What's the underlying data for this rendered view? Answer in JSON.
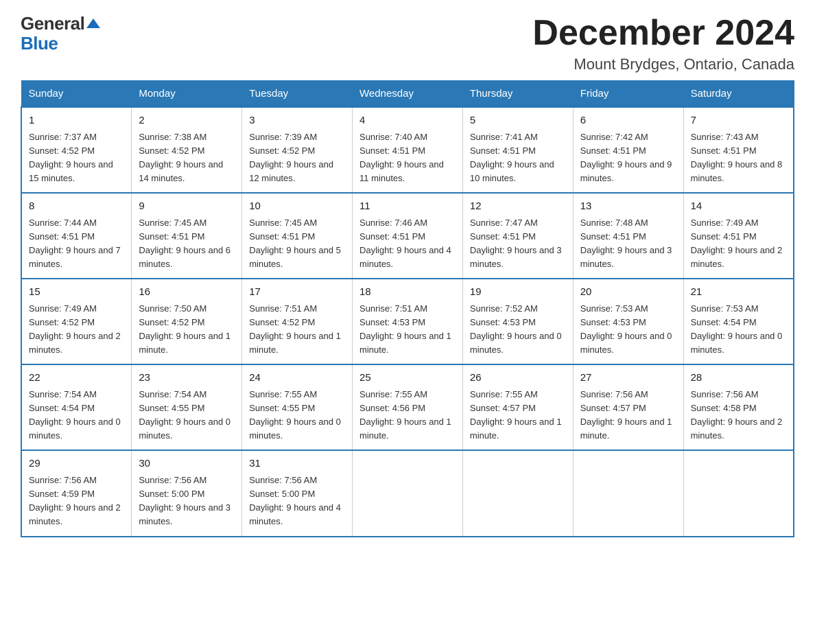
{
  "header": {
    "title": "December 2024",
    "subtitle": "Mount Brydges, Ontario, Canada",
    "logo_line1": "General",
    "logo_line2": "Blue"
  },
  "columns": [
    "Sunday",
    "Monday",
    "Tuesday",
    "Wednesday",
    "Thursday",
    "Friday",
    "Saturday"
  ],
  "weeks": [
    [
      {
        "day": "1",
        "sunrise": "Sunrise: 7:37 AM",
        "sunset": "Sunset: 4:52 PM",
        "daylight": "Daylight: 9 hours and 15 minutes."
      },
      {
        "day": "2",
        "sunrise": "Sunrise: 7:38 AM",
        "sunset": "Sunset: 4:52 PM",
        "daylight": "Daylight: 9 hours and 14 minutes."
      },
      {
        "day": "3",
        "sunrise": "Sunrise: 7:39 AM",
        "sunset": "Sunset: 4:52 PM",
        "daylight": "Daylight: 9 hours and 12 minutes."
      },
      {
        "day": "4",
        "sunrise": "Sunrise: 7:40 AM",
        "sunset": "Sunset: 4:51 PM",
        "daylight": "Daylight: 9 hours and 11 minutes."
      },
      {
        "day": "5",
        "sunrise": "Sunrise: 7:41 AM",
        "sunset": "Sunset: 4:51 PM",
        "daylight": "Daylight: 9 hours and 10 minutes."
      },
      {
        "day": "6",
        "sunrise": "Sunrise: 7:42 AM",
        "sunset": "Sunset: 4:51 PM",
        "daylight": "Daylight: 9 hours and 9 minutes."
      },
      {
        "day": "7",
        "sunrise": "Sunrise: 7:43 AM",
        "sunset": "Sunset: 4:51 PM",
        "daylight": "Daylight: 9 hours and 8 minutes."
      }
    ],
    [
      {
        "day": "8",
        "sunrise": "Sunrise: 7:44 AM",
        "sunset": "Sunset: 4:51 PM",
        "daylight": "Daylight: 9 hours and 7 minutes."
      },
      {
        "day": "9",
        "sunrise": "Sunrise: 7:45 AM",
        "sunset": "Sunset: 4:51 PM",
        "daylight": "Daylight: 9 hours and 6 minutes."
      },
      {
        "day": "10",
        "sunrise": "Sunrise: 7:45 AM",
        "sunset": "Sunset: 4:51 PM",
        "daylight": "Daylight: 9 hours and 5 minutes."
      },
      {
        "day": "11",
        "sunrise": "Sunrise: 7:46 AM",
        "sunset": "Sunset: 4:51 PM",
        "daylight": "Daylight: 9 hours and 4 minutes."
      },
      {
        "day": "12",
        "sunrise": "Sunrise: 7:47 AM",
        "sunset": "Sunset: 4:51 PM",
        "daylight": "Daylight: 9 hours and 3 minutes."
      },
      {
        "day": "13",
        "sunrise": "Sunrise: 7:48 AM",
        "sunset": "Sunset: 4:51 PM",
        "daylight": "Daylight: 9 hours and 3 minutes."
      },
      {
        "day": "14",
        "sunrise": "Sunrise: 7:49 AM",
        "sunset": "Sunset: 4:51 PM",
        "daylight": "Daylight: 9 hours and 2 minutes."
      }
    ],
    [
      {
        "day": "15",
        "sunrise": "Sunrise: 7:49 AM",
        "sunset": "Sunset: 4:52 PM",
        "daylight": "Daylight: 9 hours and 2 minutes."
      },
      {
        "day": "16",
        "sunrise": "Sunrise: 7:50 AM",
        "sunset": "Sunset: 4:52 PM",
        "daylight": "Daylight: 9 hours and 1 minute."
      },
      {
        "day": "17",
        "sunrise": "Sunrise: 7:51 AM",
        "sunset": "Sunset: 4:52 PM",
        "daylight": "Daylight: 9 hours and 1 minute."
      },
      {
        "day": "18",
        "sunrise": "Sunrise: 7:51 AM",
        "sunset": "Sunset: 4:53 PM",
        "daylight": "Daylight: 9 hours and 1 minute."
      },
      {
        "day": "19",
        "sunrise": "Sunrise: 7:52 AM",
        "sunset": "Sunset: 4:53 PM",
        "daylight": "Daylight: 9 hours and 0 minutes."
      },
      {
        "day": "20",
        "sunrise": "Sunrise: 7:53 AM",
        "sunset": "Sunset: 4:53 PM",
        "daylight": "Daylight: 9 hours and 0 minutes."
      },
      {
        "day": "21",
        "sunrise": "Sunrise: 7:53 AM",
        "sunset": "Sunset: 4:54 PM",
        "daylight": "Daylight: 9 hours and 0 minutes."
      }
    ],
    [
      {
        "day": "22",
        "sunrise": "Sunrise: 7:54 AM",
        "sunset": "Sunset: 4:54 PM",
        "daylight": "Daylight: 9 hours and 0 minutes."
      },
      {
        "day": "23",
        "sunrise": "Sunrise: 7:54 AM",
        "sunset": "Sunset: 4:55 PM",
        "daylight": "Daylight: 9 hours and 0 minutes."
      },
      {
        "day": "24",
        "sunrise": "Sunrise: 7:55 AM",
        "sunset": "Sunset: 4:55 PM",
        "daylight": "Daylight: 9 hours and 0 minutes."
      },
      {
        "day": "25",
        "sunrise": "Sunrise: 7:55 AM",
        "sunset": "Sunset: 4:56 PM",
        "daylight": "Daylight: 9 hours and 1 minute."
      },
      {
        "day": "26",
        "sunrise": "Sunrise: 7:55 AM",
        "sunset": "Sunset: 4:57 PM",
        "daylight": "Daylight: 9 hours and 1 minute."
      },
      {
        "day": "27",
        "sunrise": "Sunrise: 7:56 AM",
        "sunset": "Sunset: 4:57 PM",
        "daylight": "Daylight: 9 hours and 1 minute."
      },
      {
        "day": "28",
        "sunrise": "Sunrise: 7:56 AM",
        "sunset": "Sunset: 4:58 PM",
        "daylight": "Daylight: 9 hours and 2 minutes."
      }
    ],
    [
      {
        "day": "29",
        "sunrise": "Sunrise: 7:56 AM",
        "sunset": "Sunset: 4:59 PM",
        "daylight": "Daylight: 9 hours and 2 minutes."
      },
      {
        "day": "30",
        "sunrise": "Sunrise: 7:56 AM",
        "sunset": "Sunset: 5:00 PM",
        "daylight": "Daylight: 9 hours and 3 minutes."
      },
      {
        "day": "31",
        "sunrise": "Sunrise: 7:56 AM",
        "sunset": "Sunset: 5:00 PM",
        "daylight": "Daylight: 9 hours and 4 minutes."
      },
      null,
      null,
      null,
      null
    ]
  ]
}
